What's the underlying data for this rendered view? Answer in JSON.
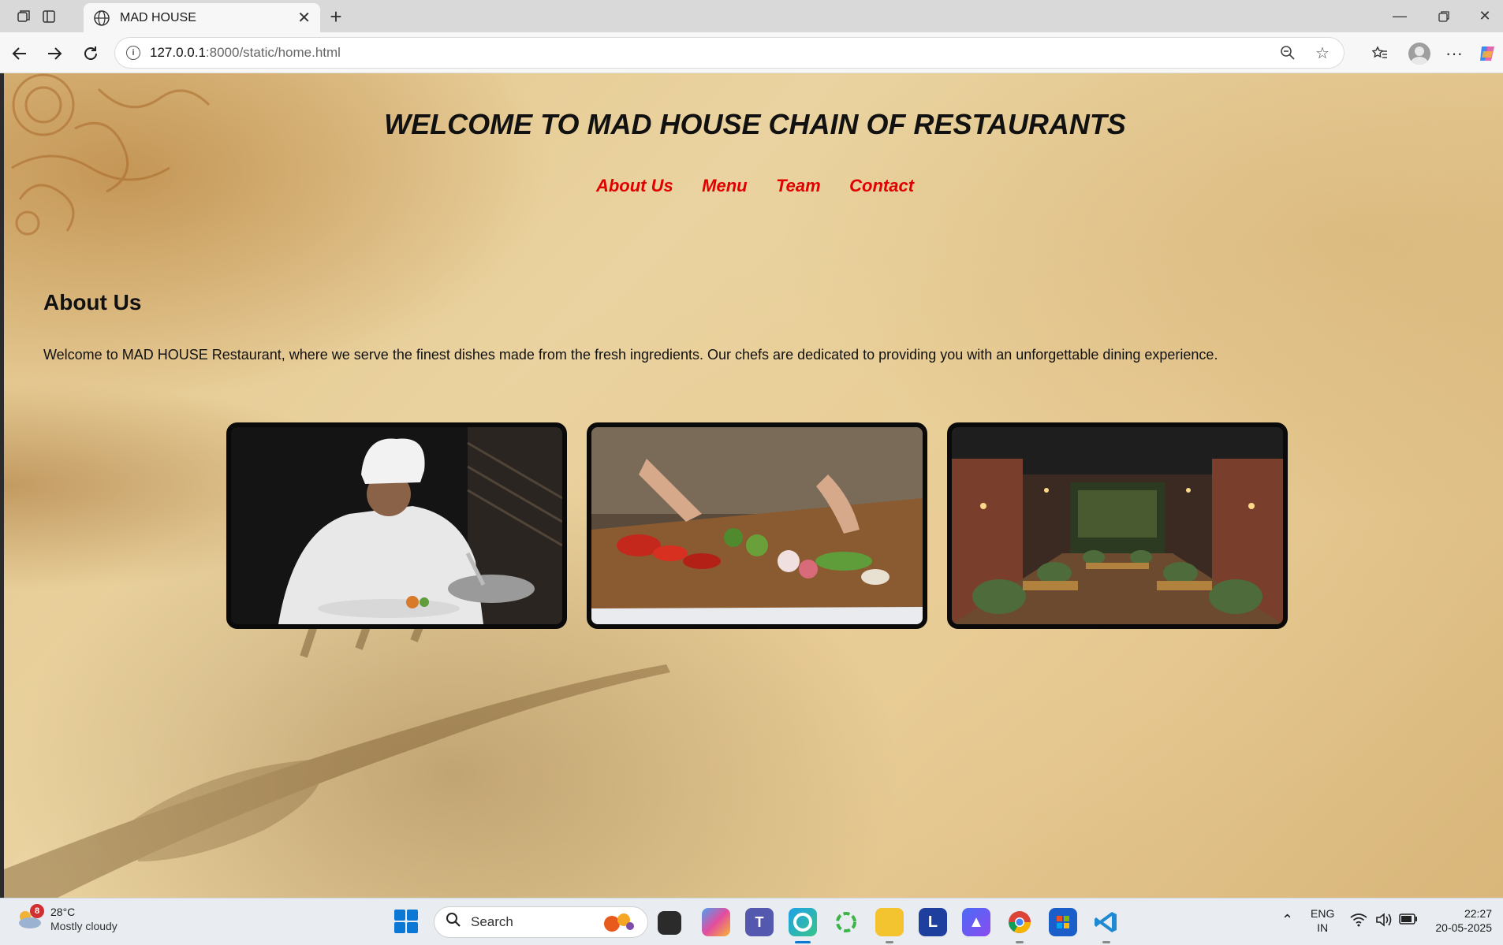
{
  "browser": {
    "tab_title": "MAD HOUSE",
    "url_host": "127.0.0.1",
    "url_rest": ":8000/static/home.html"
  },
  "page": {
    "title": "WELCOME TO MAD HOUSE CHAIN OF RESTAURANTS",
    "nav": [
      "About Us",
      "Menu",
      "Team",
      "Contact"
    ],
    "about_heading": "About Us",
    "about_text": "Welcome to MAD HOUSE Restaurant, where we serve the finest dishes made from the fresh ingredients. Our chefs are dedicated to providing you with an unforgettable dining experience.",
    "colors": {
      "nav_link": "#e00000",
      "title": "#111111",
      "parchment": "#e6cb94"
    },
    "images": [
      "chef plating dish",
      "hands preparing vegetables on board",
      "restaurant interior"
    ]
  },
  "taskbar": {
    "weather_badge": "8",
    "temperature": "28°C",
    "condition": "Mostly cloudy",
    "search_placeholder": "Search",
    "lang_top": "ENG",
    "lang_bottom": "IN",
    "time": "22:27",
    "date": "20-05-2025"
  }
}
